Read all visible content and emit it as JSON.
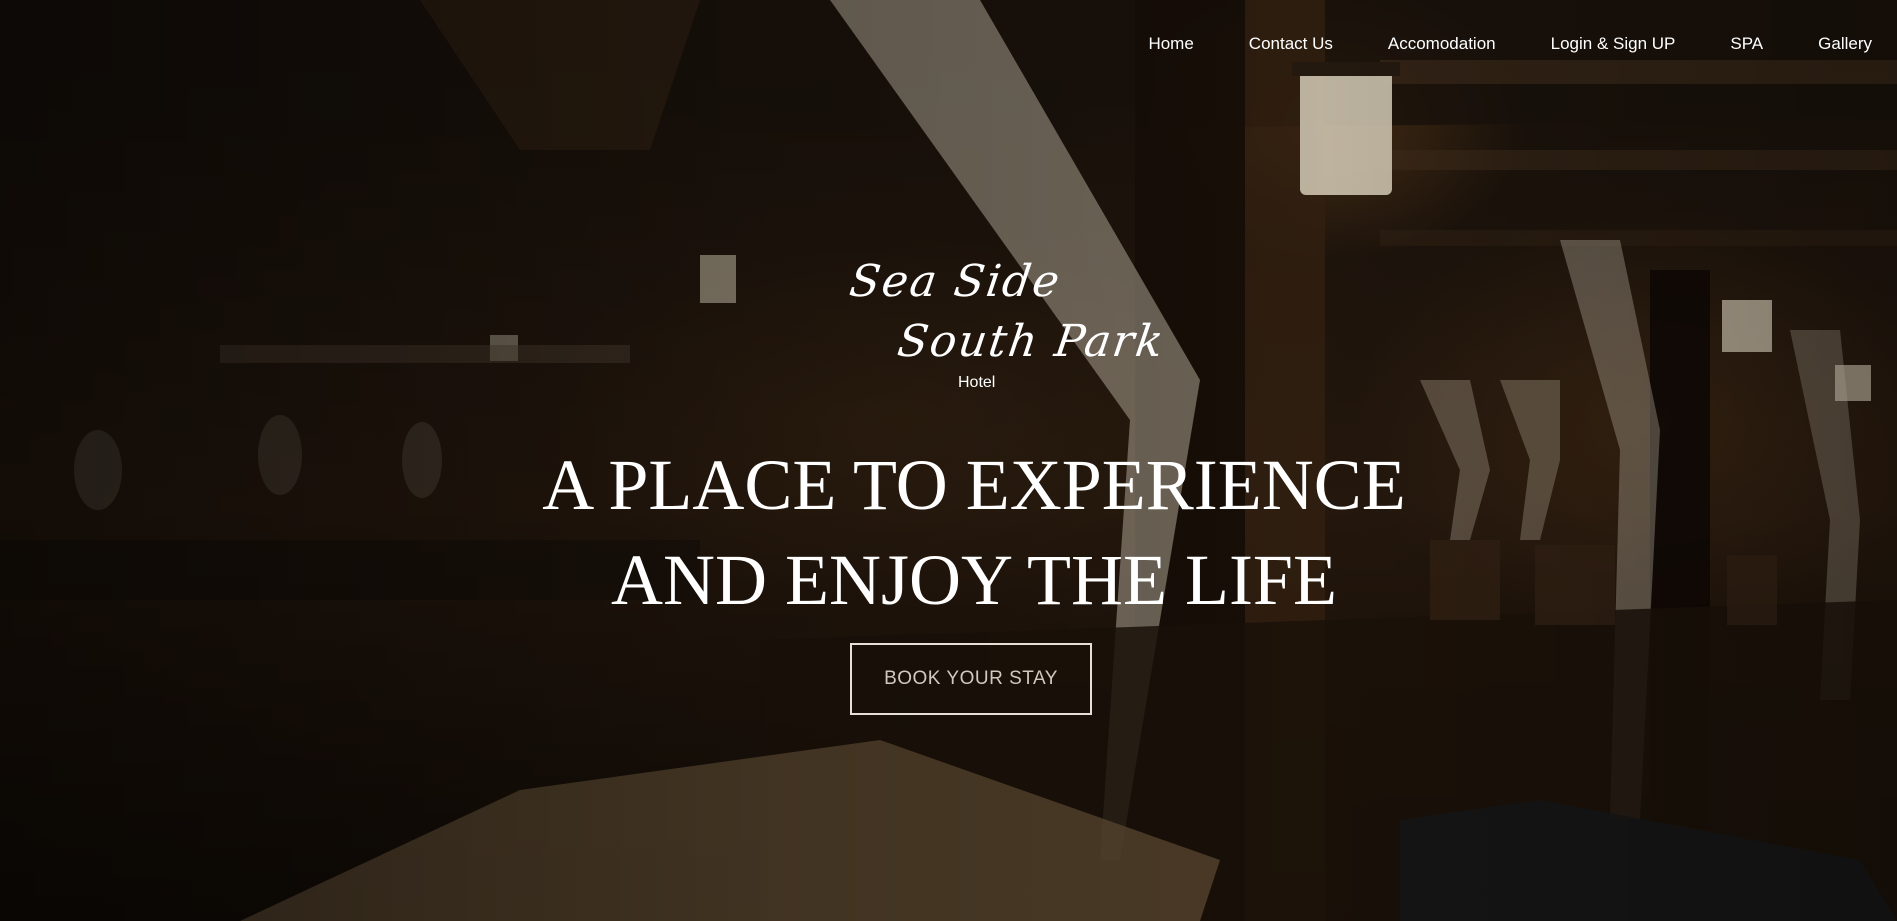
{
  "nav": {
    "items": [
      {
        "label": "Home"
      },
      {
        "label": "Contact Us"
      },
      {
        "label": "Accomodation"
      },
      {
        "label": "Login & Sign UP"
      },
      {
        "label": "SPA"
      },
      {
        "label": "Gallery"
      }
    ]
  },
  "logo": {
    "line1": "Sea Side",
    "line2": "South Park",
    "sub": "Hotel"
  },
  "hero": {
    "headline_line1": "A PLACE TO EXPERIENCE",
    "headline_line2": "AND ENJOY THE LIFE",
    "cta_label": "BOOK YOUR STAY"
  },
  "colors": {
    "text": "#ffffff",
    "cta_border": "#e6e0d6",
    "background": "#1a120b"
  }
}
